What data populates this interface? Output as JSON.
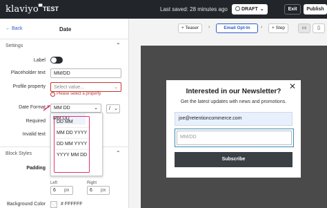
{
  "topbar": {
    "logo": "klaviyo",
    "logo_flag": "▀",
    "campaign_name": "TEST",
    "last_saved": "Last saved: 28 minutes ago",
    "status": "DRAFT",
    "exit_label": "Exit",
    "publish_label": "Publish"
  },
  "panel": {
    "back_label": "Back",
    "title": "Date",
    "settings_header": "Settings",
    "label_label": "Label",
    "placeholder_label": "Placeholder text",
    "placeholder_value": "MM/DD",
    "profile_property_label": "Profile property",
    "profile_property_placeholder": "Select value...",
    "profile_property_error": "Please select a property",
    "date_format_label": "Date Format",
    "date_format_value": "MM DD",
    "separator_value": "/",
    "required_label": "Required",
    "invalid_text_label": "Invalid text",
    "block_styles_header": "Block Styles",
    "padding_label": "Padding",
    "left_label": "Left",
    "left_value": "6",
    "left_unit": "px",
    "right_label": "Right",
    "right_value": "6",
    "right_unit": "px",
    "background_color_label": "Background Color",
    "background_color_value": "# FFFFFF"
  },
  "date_format_options": [
    "MM DD",
    "DD MM",
    "MM DD YYYY",
    "DD MM YYYY",
    "YYYY MM DD"
  ],
  "toolbar": {
    "teaser_label": "Teaser",
    "email_optin_label": "Email Opt-In",
    "step_label": "Step",
    "desktop_icon": "desktop-icon",
    "mobile_icon": "mobile-icon"
  },
  "popup": {
    "title": "Interested in our Newsletter?",
    "subtitle": "Get the latest updates with news and promotions.",
    "email_value": "joe@retentioncommerce.com",
    "date_placeholder": "MM/DD",
    "subscribe_label": "Subscribe"
  },
  "colors": {
    "accent": "#2d5cc8",
    "error": "#c0352f",
    "highlight": "#e0336b",
    "topbar": "#22262b"
  }
}
